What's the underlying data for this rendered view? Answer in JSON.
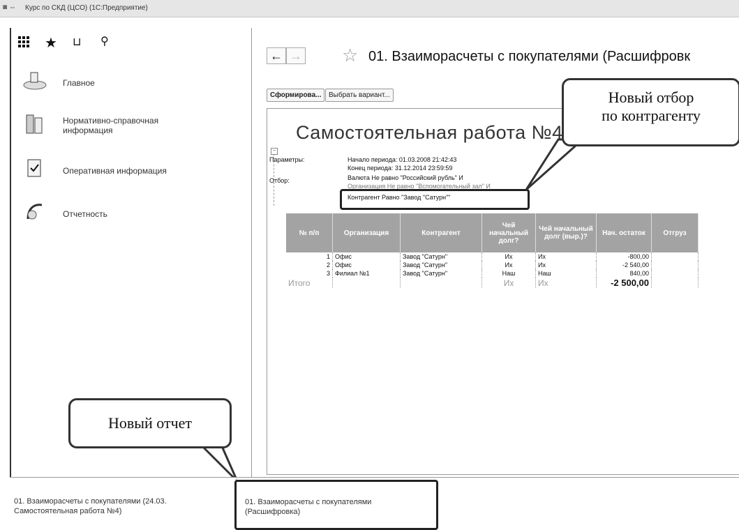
{
  "window": {
    "title": "Курс по СКД (ЦСО) (1С:Предприятие)"
  },
  "toolbar": {
    "icons": [
      "apps-grid-icon",
      "star-icon",
      "history-icon",
      "search-icon"
    ]
  },
  "sidebar": {
    "items": [
      {
        "label": "Главное",
        "icon": "home-icon"
      },
      {
        "label": "Нормативно-справочная информация",
        "icon": "reference-icon"
      },
      {
        "label": "Оперативная информация",
        "icon": "clipboard-icon"
      },
      {
        "label": "Отчетность",
        "icon": "report-icon"
      }
    ]
  },
  "form": {
    "title": "01. Взаиморасчеты с покупателями (Расшифровк",
    "back_label": "←",
    "forward_label": "→",
    "generate_button": "Сформирова...",
    "variant_button": "Выбрать вариант..."
  },
  "report": {
    "title": "Самостоятельная работа №4",
    "params_label": "Параметры:",
    "param_line1": "Начало периода: 01.03.2008 21:42:43",
    "param_line2": "Конец периода: 31.12.2014 23:59:59",
    "filter_label": "Отбор:",
    "filter_line1": "Валюта Не равно \"Российский рубль\" И",
    "filter_line2": "Организация Не равно \"Вспомогательный зал\" И",
    "filter_line3": "Контрагент Равно \"Завод \"Сатурн\"\"",
    "columns": [
      "№ п/п",
      "Организация",
      "Контрагент",
      "Чей начальный долг?",
      "Чей начальный долг (выр.)?",
      "Нач. остаток",
      "Отгруз"
    ],
    "rows": [
      [
        "1",
        "Офис",
        "Завод \"Сатурн\"",
        "Их",
        "Их",
        "-800,00"
      ],
      [
        "2",
        "Офис",
        "Завод \"Сатурн\"",
        "Их",
        "Их",
        "-2 540,00"
      ],
      [
        "3",
        "Филиал №1",
        "Завод \"Сатурн\"",
        "Наш",
        "Наш",
        "840,00"
      ]
    ],
    "total": {
      "label": "Итого",
      "debt": "Их",
      "debt_expr": "Их",
      "balance": "-2 500,00"
    }
  },
  "callouts": {
    "filter_line1": "Новый отбор",
    "filter_line2": "по контрагенту",
    "report": "Новый отчет"
  },
  "bottom_tabs": [
    {
      "line1": "01. Взаиморасчеты с покупателями (24.03.",
      "line2": "Самостоятельная работа №4)"
    },
    {
      "line1": "01. Взаиморасчеты с покупателями",
      "line2": "(Расшифровка)"
    }
  ]
}
